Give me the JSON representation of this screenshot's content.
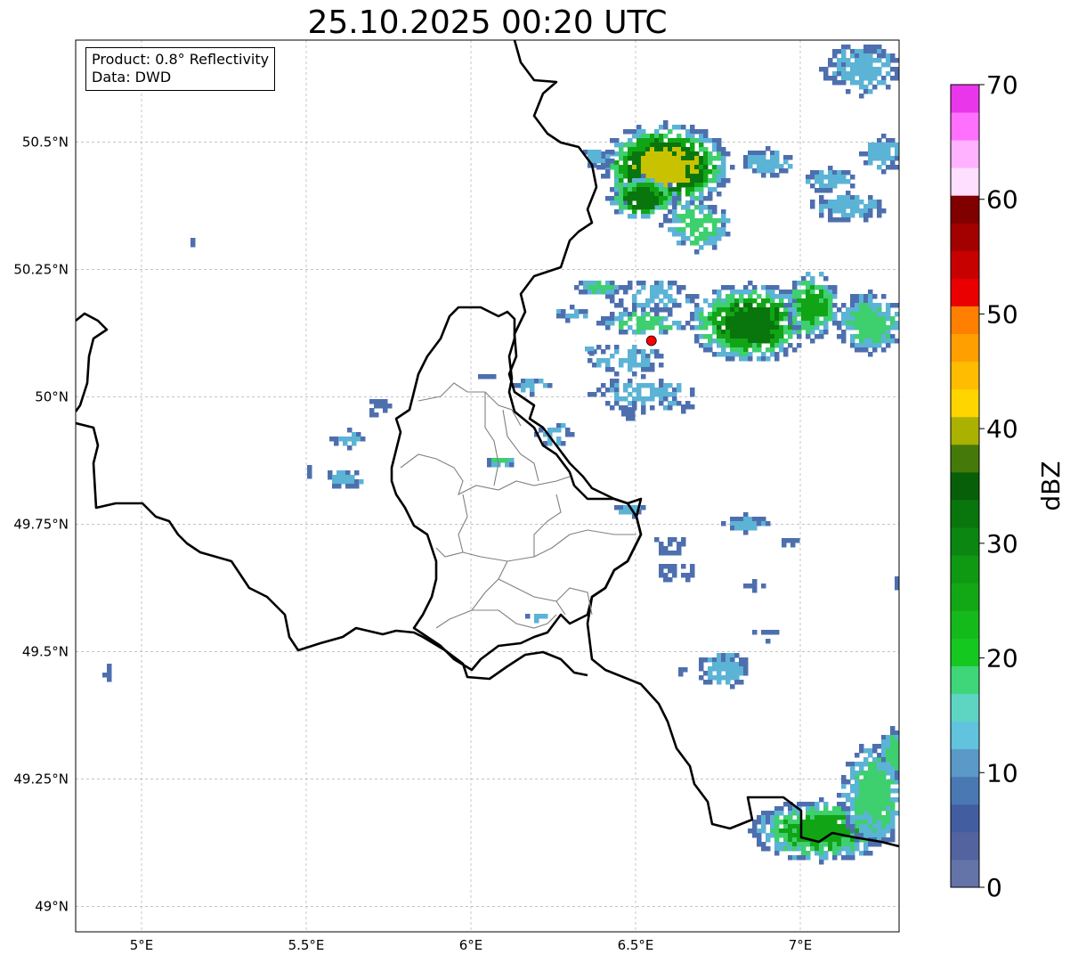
{
  "title": "25.10.2025 00:20 UTC",
  "info": {
    "product": "Product: 0.8° Reflectivity",
    "source": "Data: DWD"
  },
  "axes": {
    "lon_range": [
      4.8,
      7.3
    ],
    "lat_range": [
      48.95,
      50.7
    ],
    "x_ticks": [
      {
        "value": 5.0,
        "label": "5°E"
      },
      {
        "value": 5.5,
        "label": "5.5°E"
      },
      {
        "value": 6.0,
        "label": "6°E"
      },
      {
        "value": 6.5,
        "label": "6.5°E"
      },
      {
        "value": 7.0,
        "label": "7°E"
      }
    ],
    "y_ticks": [
      {
        "value": 49.0,
        "label": "49°N"
      },
      {
        "value": 49.25,
        "label": "49.25°N"
      },
      {
        "value": 49.5,
        "label": "49.5°N"
      },
      {
        "value": 49.75,
        "label": "49.75°N"
      },
      {
        "value": 50.0,
        "label": "50°N"
      },
      {
        "value": 50.25,
        "label": "50.25°N"
      },
      {
        "value": 50.5,
        "label": "50.5°N"
      }
    ],
    "grid": true
  },
  "radar_site": {
    "lon": 6.548,
    "lat": 50.11,
    "color": "#ff0000"
  },
  "colorbar": {
    "unit": "dBZ",
    "min": 0,
    "max": 70,
    "tick_labels": [
      "0",
      "10",
      "20",
      "30",
      "40",
      "50",
      "60",
      "70"
    ],
    "tick_values": [
      0,
      10,
      20,
      30,
      40,
      50,
      60,
      70
    ],
    "colors": [
      "#6473a8",
      "#52639f",
      "#435da1",
      "#4a78b3",
      "#5a99c8",
      "#62c3df",
      "#5ed5c2",
      "#3ed679",
      "#15c81f",
      "#14b91b",
      "#12a815",
      "#0f9812",
      "#0b8611",
      "#08760d",
      "#075f0a",
      "#457a0a",
      "#aab100",
      "#ffd500",
      "#ffbc00",
      "#ff9f00",
      "#ff7f00",
      "#ea0000",
      "#c70000",
      "#a30000",
      "#800000",
      "#ffdfff",
      "#ffb2ff",
      "#ff70ff",
      "#ea36ea"
    ]
  },
  "echo_legend_levels": {
    "weak": "#4e6fae",
    "light": "#5bb3d6",
    "moderate": "#3ecf6e",
    "strong": "#11a516",
    "heavy": "#08760d",
    "intense": "#c9c200"
  }
}
